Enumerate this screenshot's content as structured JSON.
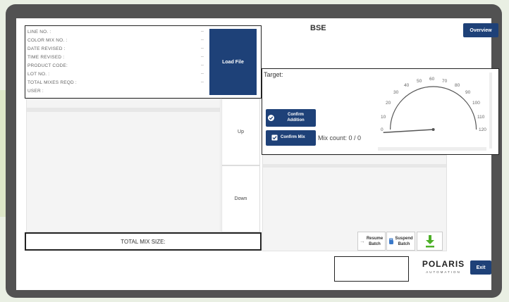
{
  "title": "BSE",
  "overview_label": "Overview",
  "load_file_label": "Load File",
  "info_fields": [
    {
      "label": "LINE NO. :",
      "sep": "--"
    },
    {
      "label": "COLOR MIX NO. :",
      "sep": "--"
    },
    {
      "label": "DATE REVISED :",
      "sep": "--"
    },
    {
      "label": "TIME REVISED :",
      "sep": "--"
    },
    {
      "label": "PRODUCT CODE:",
      "sep": "--"
    },
    {
      "label": "LOT NO. :",
      "sep": "--"
    },
    {
      "label": "TOTAL MIXES REQD :",
      "sep": "--"
    },
    {
      "label": "USER :",
      "sep": ""
    }
  ],
  "up_label": "Up",
  "down_label": "Down",
  "total_mix_size_label": "TOTAL MIX SIZE:",
  "target_label": "Target:",
  "confirm_addition": {
    "line1": "Confirm",
    "line2": "Addition"
  },
  "confirm_mix_label": "Confirm Mix",
  "mix_count": "Mix count: 0 / 0",
  "gauge": {
    "ticks": [
      "0",
      "10",
      "20",
      "30",
      "40",
      "50",
      "60",
      "70",
      "80",
      "90",
      "100",
      "110",
      "120"
    ],
    "value": 0,
    "min": 0,
    "max": 120
  },
  "resume_batch": {
    "line1": "Resume",
    "line2": "Batch"
  },
  "suspend_batch": {
    "line1": "Suspend",
    "line2": "Batch"
  },
  "logo": {
    "name": "POLARIS",
    "sub": "AUTOMATION"
  },
  "exit_label": "Exit",
  "colors": {
    "primary": "#1e4178",
    "download_green": "#4caf27"
  }
}
